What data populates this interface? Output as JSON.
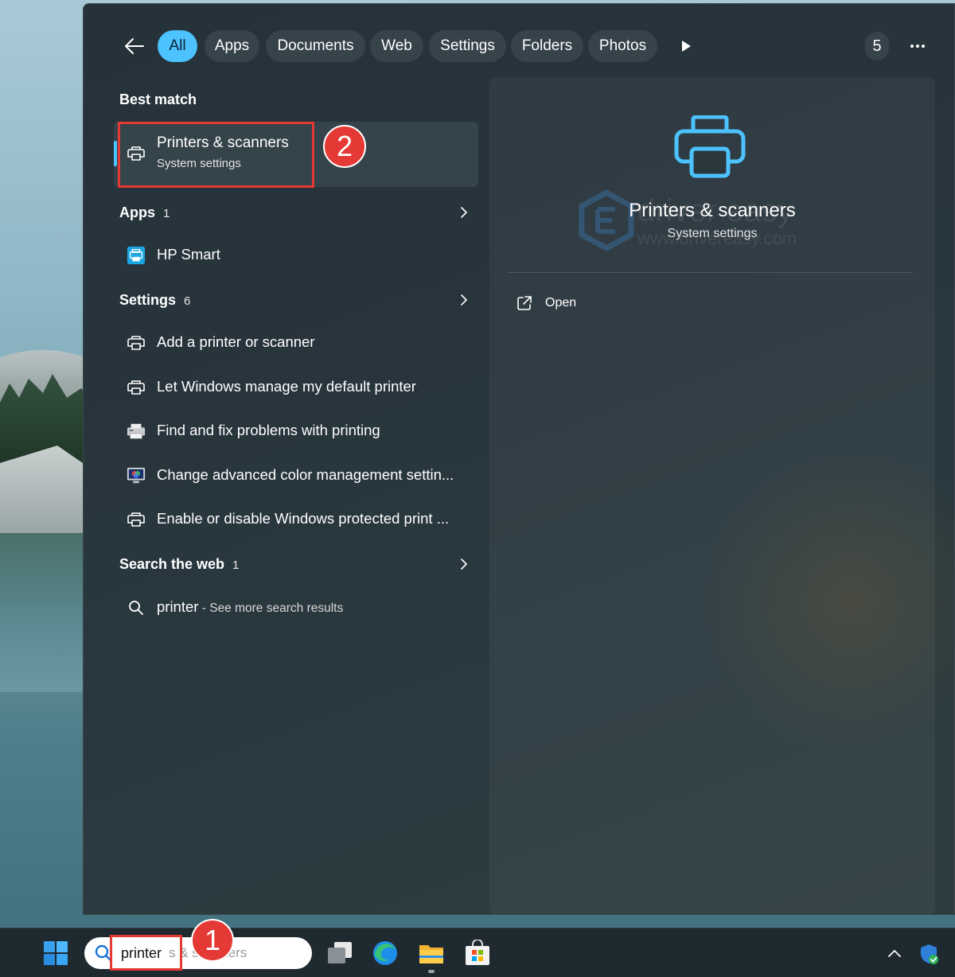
{
  "filters": {
    "back_icon": "arrow-left-icon",
    "tabs": [
      {
        "label": "All",
        "active": true
      },
      {
        "label": "Apps",
        "active": false
      },
      {
        "label": "Documents",
        "active": false
      },
      {
        "label": "Web",
        "active": false
      },
      {
        "label": "Settings",
        "active": false
      },
      {
        "label": "Folders",
        "active": false
      },
      {
        "label": "Photos",
        "active": false
      }
    ],
    "more_icon": "play-arrow-icon",
    "count": "5",
    "overflow_icon": "ellipsis-icon"
  },
  "results": {
    "best_match": {
      "heading": "Best match",
      "title": "Printers & scanners",
      "subtitle": "System settings",
      "icon": "printer-icon"
    },
    "apps": {
      "heading": "Apps",
      "count": "1",
      "items": [
        {
          "label": "HP Smart",
          "icon": "hp-smart-icon"
        }
      ]
    },
    "settings": {
      "heading": "Settings",
      "count": "6",
      "items": [
        {
          "label": "Add a printer or scanner",
          "icon": "printer-icon"
        },
        {
          "label": "Let Windows manage my default printer",
          "icon": "printer-icon"
        },
        {
          "label": "Find and fix problems with printing",
          "icon": "printer-troubleshoot-icon"
        },
        {
          "label": "Change advanced color management settin...",
          "icon": "monitor-color-icon"
        },
        {
          "label": "Enable or disable Windows protected print ...",
          "icon": "printer-icon"
        }
      ]
    },
    "web": {
      "heading": "Search the web",
      "count": "1",
      "query": "printer",
      "suffix": " - See more search results",
      "icon": "search-icon"
    }
  },
  "preview": {
    "title": "Printers & scanners",
    "subtitle": "System settings",
    "icon": "printer-icon",
    "open_label": "Open",
    "open_icon": "open-external-icon"
  },
  "watermark": {
    "text": "driver easy",
    "url": "www.drivereasy.com"
  },
  "annotations": {
    "step1": "1",
    "step2": "2"
  },
  "taskbar": {
    "search_value": "printer",
    "search_hint": "s & scanners",
    "items": [
      "windows-start-icon",
      "task-view-icon",
      "edge-icon",
      "file-explorer-icon",
      "microsoft-store-icon"
    ],
    "tray": [
      "chevron-up-icon",
      "windows-security-icon"
    ]
  },
  "colors": {
    "accent": "#4cc2ff",
    "annotation": "#e53935",
    "panel": "#28353d"
  }
}
